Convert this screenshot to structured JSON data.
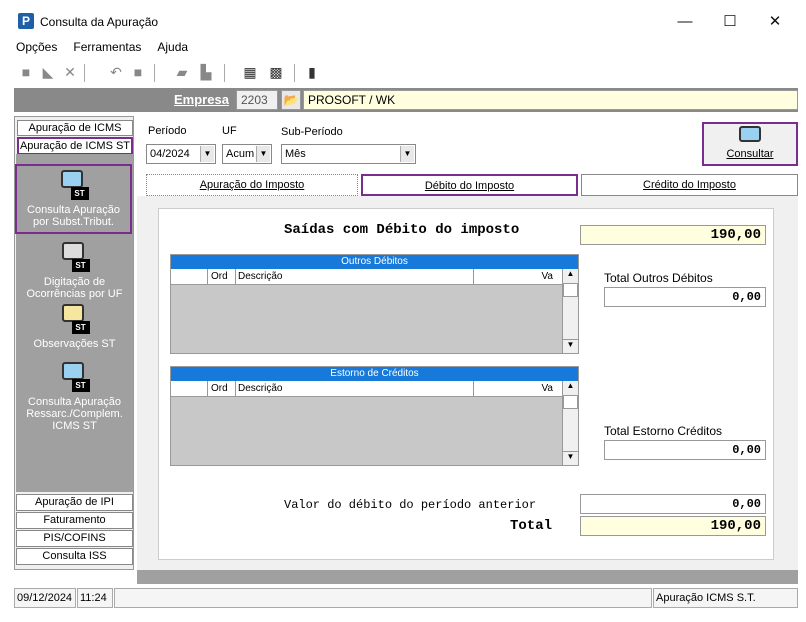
{
  "window": {
    "title": "Consulta da Apuração",
    "app_icon": "P",
    "minimize": "—",
    "maximize": "☐",
    "close": "✕"
  },
  "menu": {
    "items": [
      "Opções",
      "Ferramentas",
      "Ajuda"
    ]
  },
  "empresa": {
    "label": "Empresa",
    "code": "2203",
    "name": "PROSOFT / WK"
  },
  "left_tabs": {
    "top": [
      "Apuração de ICMS",
      "Apuração de ICMS ST"
    ],
    "bottom": [
      "Apuração de IPI",
      "Faturamento",
      "PIS/COFINS",
      "Consulta ISS"
    ]
  },
  "nav": {
    "consulta_st": "Consulta Apuração por Subst.Tribut.",
    "digitacao": "Digitação de Ocorrências por UF",
    "observacoes": "Observações ST",
    "ressarc": "Consulta Apuração Ressarc./Complem. ICMS ST",
    "icon_badge": "ST"
  },
  "form": {
    "periodo_label": "Período",
    "periodo_value": "04/2024",
    "uf_label": "UF",
    "uf_value": "Acum",
    "subperiodo_label": "Sub-Período",
    "subperiodo_value": "Mês",
    "consultar": "Consultar"
  },
  "tabs": [
    "Apuração do Imposto",
    "Débito do Imposto",
    "Crédito do Imposto"
  ],
  "debito": {
    "saidas_label": "Saídas com Débito do imposto",
    "saidas_value": "190,00",
    "outros_title": "Outros Débitos",
    "col_ord": "Ord",
    "col_desc": "Descrição",
    "col_val": "Va",
    "total_outros_label": "Total Outros Débitos",
    "total_outros_value": "0,00",
    "estorno_title": "Estorno de Créditos",
    "total_estorno_label": "Total Estorno Créditos",
    "total_estorno_value": "0,00",
    "anterior_label": "Valor do débito do período anterior",
    "anterior_value": "0,00",
    "total_label": "Total",
    "total_value": "190,00"
  },
  "status": {
    "date": "09/12/2024",
    "time": "11:24",
    "module": "Apuração ICMS S.T."
  },
  "colors": {
    "highlight": "#7b2d8e",
    "grid_header": "#1779d9",
    "yellow": "#ffffe0"
  }
}
